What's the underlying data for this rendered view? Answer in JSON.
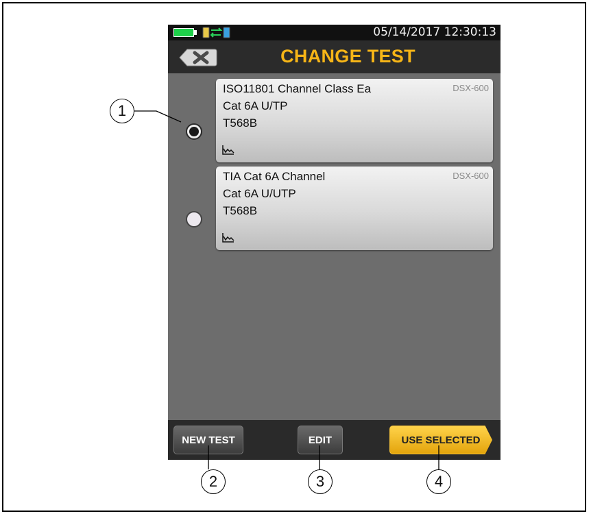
{
  "status_bar": {
    "datetime": "05/14/2017 12:30:13",
    "battery_icon": "battery-icon",
    "link_icon": "connection-icon"
  },
  "header": {
    "title": "CHANGE TEST",
    "close_icon": "close-icon"
  },
  "tests": [
    {
      "name": "ISO11801 Channel Class Ea",
      "cable": "Cat 6A U/TP",
      "wiring": "T568B",
      "model": "DSX-600",
      "selected": true,
      "icon": "graph-icon"
    },
    {
      "name": "TIA Cat 6A Channel",
      "cable": "Cat 6A U/UTP",
      "wiring": "T568B",
      "model": "DSX-600",
      "selected": false,
      "icon": "graph-icon"
    }
  ],
  "buttons": {
    "new_test": "NEW TEST",
    "edit": "EDIT",
    "use_selected": "USE SELECTED"
  },
  "callouts": [
    "1",
    "2",
    "3",
    "4"
  ],
  "colors": {
    "title_accent": "#f6b517",
    "primary_button": "#f2b823",
    "screen_background": "#6d6d6d",
    "header_background": "#2b2b2b"
  }
}
